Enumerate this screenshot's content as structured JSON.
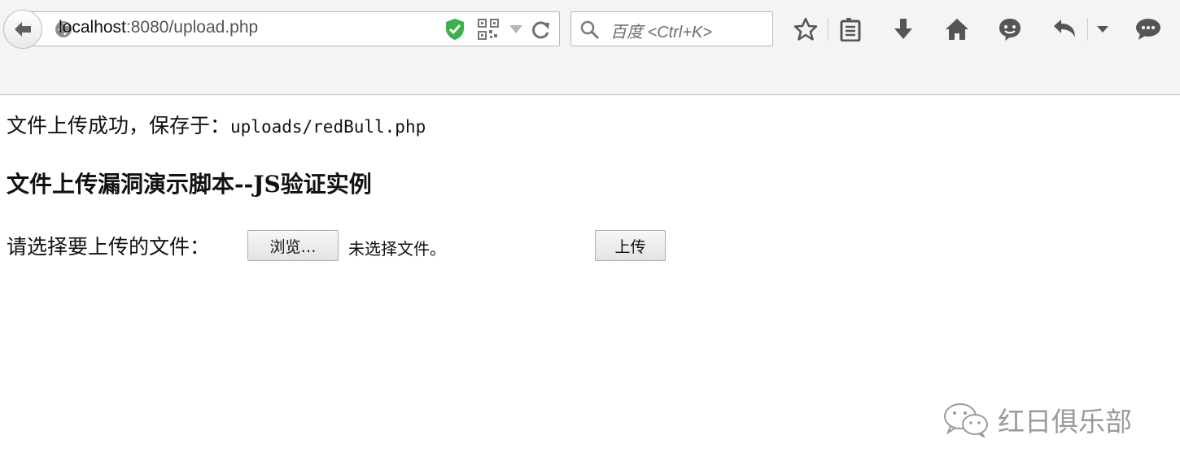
{
  "browser": {
    "url_host": "localhost",
    "url_path": ":8080/upload.php",
    "search_placeholder": "百度 <Ctrl+K>",
    "icons": [
      "back-arrow-icon",
      "globe-icon",
      "shield-check-icon",
      "qr-code-icon",
      "dropdown-triangle-icon",
      "reload-icon",
      "search-icon",
      "star-icon",
      "reading-list-icon",
      "download-icon",
      "home-icon",
      "chat-icon",
      "undo-icon",
      "menu-dropdown-icon",
      "speech-bubble-icon"
    ],
    "accent": "#3cb04a"
  },
  "page": {
    "message_prefix": "文件上传成功，保存于：",
    "message_path": "uploads/redBull.php",
    "heading": "文件上传漏洞演示脚本--JS验证实例",
    "file_label": "请选择要上传的文件：",
    "browse_label": "浏览…",
    "no_file_text": "未选择文件。",
    "upload_label": "上传"
  },
  "watermark": {
    "text": "红日俱乐部"
  }
}
